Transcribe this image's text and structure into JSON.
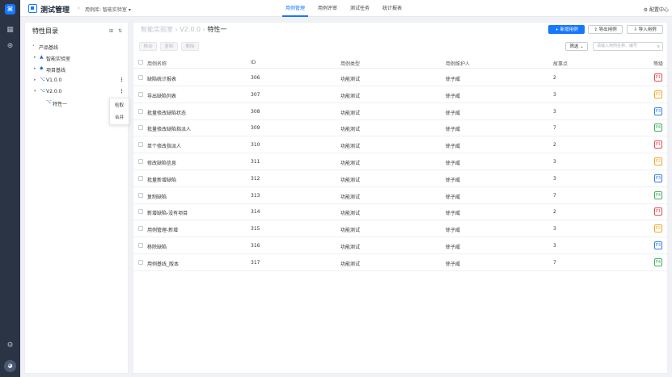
{
  "app": {
    "title": "测试管理",
    "library_label": "用例库: 智能实验室",
    "nav": [
      "用例管理",
      "用例评审",
      "测试任务",
      "统计报表"
    ],
    "active_nav": "用例管理",
    "config_label": "配置中心"
  },
  "sidebar_panel": {
    "title": "特性目录",
    "tree": [
      {
        "label": "产品基线",
        "level": 0,
        "caret": "",
        "icon": ""
      },
      {
        "label": "智能实验室",
        "level": 1,
        "caret": "▸",
        "icon": "▲"
      },
      {
        "label": "项目基线",
        "level": 1,
        "caret": "▸",
        "icon": "◆"
      },
      {
        "label": "V1.0.0",
        "level": 1,
        "caret": "▸",
        "icon": "⌥",
        "more": true
      },
      {
        "label": "V2.0.0",
        "level": 1,
        "caret": "▾",
        "icon": "⌥",
        "more": true
      },
      {
        "label": "特性一",
        "level": 2,
        "caret": "",
        "icon": "⌥"
      }
    ],
    "context_menu": [
      "检取",
      "合并"
    ]
  },
  "main": {
    "breadcrumb": [
      "智能实验室",
      "V2.0.0",
      "特性一"
    ],
    "buttons": {
      "new_case": "+ 新增用例",
      "export": "导出用例",
      "import": "导入用例",
      "move": "移动",
      "copy": "复制",
      "delete": "删除",
      "filter": "筛选"
    },
    "search_placeholder": "请输入用例名称、编号",
    "columns": [
      "用例名称",
      "ID",
      "用例类型",
      "用例维护人",
      "故事点",
      "等级"
    ],
    "rows": [
      {
        "name": "缺陷统计报表",
        "id": "306",
        "type": "功能测试",
        "owner": "徐子威",
        "points": "2",
        "level": "P1"
      },
      {
        "name": "导出缺陷列表",
        "id": "307",
        "type": "功能测试",
        "owner": "徐子威",
        "points": "3",
        "level": "P2"
      },
      {
        "name": "批量修改缺陷状态",
        "id": "308",
        "type": "功能测试",
        "owner": "徐子威",
        "points": "3",
        "level": "P3"
      },
      {
        "name": "批量修改缺陷指派人",
        "id": "309",
        "type": "功能测试",
        "owner": "徐子威",
        "points": "7",
        "level": "P4"
      },
      {
        "name": "单个修改指派人",
        "id": "310",
        "type": "功能测试",
        "owner": "徐子威",
        "points": "2",
        "level": "P1"
      },
      {
        "name": "修改缺陷信息",
        "id": "311",
        "type": "功能测试",
        "owner": "徐子威",
        "points": "3",
        "level": "P2"
      },
      {
        "name": "批量新增缺陷",
        "id": "312",
        "type": "功能测试",
        "owner": "徐子威",
        "points": "3",
        "level": "P3"
      },
      {
        "name": "复制缺陷",
        "id": "313",
        "type": "功能测试",
        "owner": "徐子威",
        "points": "7",
        "level": "P4"
      },
      {
        "name": "新增缺陷-没有项目",
        "id": "314",
        "type": "功能测试",
        "owner": "徐子威",
        "points": "2",
        "level": "P1"
      },
      {
        "name": "用例管理-新增",
        "id": "315",
        "type": "功能测试",
        "owner": "徐子威",
        "points": "3",
        "level": "P2"
      },
      {
        "name": "移除缺陷",
        "id": "316",
        "type": "功能测试",
        "owner": "徐子威",
        "points": "3",
        "level": "P3"
      },
      {
        "name": "用例基线_版本",
        "id": "317",
        "type": "功能测试",
        "owner": "徐子威",
        "points": "7",
        "level": "P4"
      }
    ]
  },
  "colors": {
    "primary": "#1677ff",
    "rail": "#2b3445",
    "P1": "#e5484d",
    "P2": "#f5a524",
    "P3": "#2f7bf6",
    "P4": "#3fae5a"
  }
}
